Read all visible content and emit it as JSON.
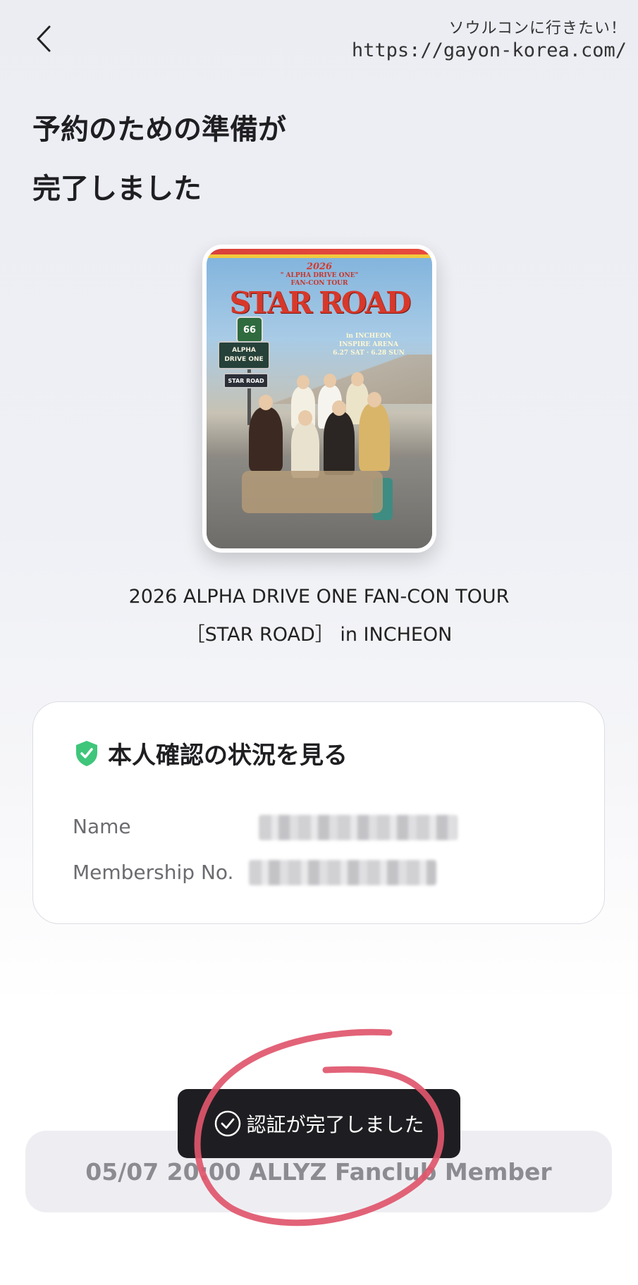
{
  "header": {
    "back_icon": "chevron-left-icon",
    "watermark_line1": "ソウルコンに行きたい！",
    "watermark_line2": "https://gayon-korea.com/"
  },
  "heading": {
    "line1": "予約のための準備が",
    "line2": "完了しました"
  },
  "poster": {
    "year": "2026",
    "subtitle_line1": "\" ALPHA DRIVE ONE\"",
    "subtitle_line2": "FAN-CON TOUR",
    "title": "STAR ROAD",
    "venue_line1": "in INCHEON",
    "venue_line2": "INSPIRE ARENA",
    "venue_line3": "6.27 SAT · 6.28 SUN",
    "sign_66": "66",
    "sign_main_line1": "ALPHA",
    "sign_main_line2": "DRIVE ONE",
    "sign_road": "STAR ROAD"
  },
  "event": {
    "title_line1": "2026 ALPHA DRIVE ONE FAN-CON TOUR",
    "title_line2": "［STAR ROAD］ in INCHEON"
  },
  "identity_card": {
    "icon": "shield-check-icon",
    "title": "本人確認の状況を見る",
    "name_label": "Name",
    "name_value": "",
    "membership_label": "Membership No.",
    "membership_value": ""
  },
  "bottom_button": {
    "label": "05/07 20:00 ALLYZ Fanclub Member"
  },
  "toast": {
    "icon": "check-circle-icon",
    "message": "認証が完了しました"
  },
  "colors": {
    "accent_green": "#3fc67a",
    "annotation_red": "#e0566c",
    "toast_bg": "#1e1e22"
  }
}
